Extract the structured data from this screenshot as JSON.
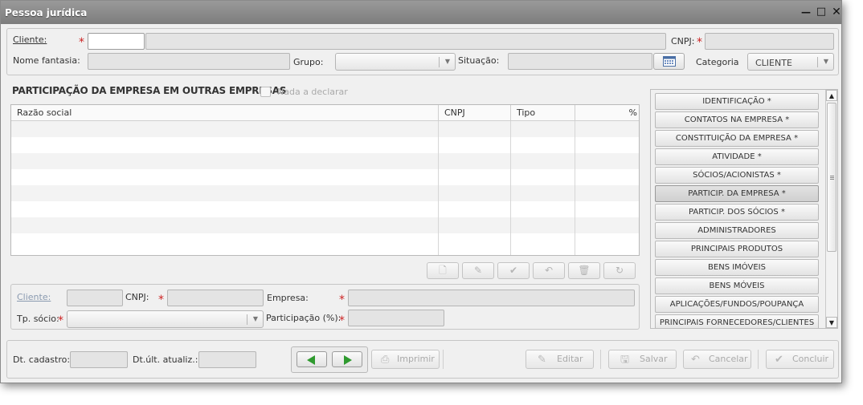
{
  "window": {
    "title": "Pessoa jurídica"
  },
  "header": {
    "cliente_label": "Cliente:",
    "cliente_value": "",
    "cliente_name": "",
    "cnpj_label": "CNPJ:",
    "nome_fantasia_label": "Nome fantasia:",
    "grupo_label": "Grupo:",
    "situacao_label": "Situação:",
    "categoria_label": "Categoria",
    "categoria_value": "CLIENTE"
  },
  "section": {
    "title": "PARTICIPAÇÃO DA EMPRESA EM OUTRAS EMPRESAS",
    "nada_label": "Nada a declarar"
  },
  "grid": {
    "columns": [
      "Razão social",
      "CNPJ",
      "Tipo",
      "%"
    ],
    "rows": []
  },
  "detail": {
    "cliente_label": "Cliente:",
    "cnpj_label": "CNPJ:",
    "empresa_label": "Empresa:",
    "tp_socio_label": "Tp. sócio:",
    "participacao_label": "Participação (%):"
  },
  "nav": {
    "items": [
      "IDENTIFICAÇÃO *",
      "CONTATOS NA EMPRESA *",
      "CONSTITUIÇÃO DA EMPRESA *",
      "ATIVIDADE *",
      "SÓCIOS/ACIONISTAS *",
      "PARTICIP. DA EMPRESA *",
      "PARTICIP. DOS SÓCIOS *",
      "ADMINISTRADORES",
      "PRINCIPAIS PRODUTOS",
      "BENS IMÓVEIS",
      "BENS MÓVEIS",
      "APLICAÇÕES/FUNDOS/POUPANÇA",
      "PRINCIPAIS FORNECEDORES/CLIENTES"
    ],
    "active_index": 5
  },
  "footer": {
    "dt_cadastro_label": "Dt. cadastro:",
    "dt_ult_label": "Dt.últ. atualiz.:",
    "imprimir": "Imprimir",
    "editar": "Editar",
    "salvar": "Salvar",
    "cancelar": "Cancelar",
    "concluir": "Concluir"
  },
  "colors": {
    "accent_green": "#2f9a2f",
    "required_red": "#cc2222",
    "titlebar": "#8a8a8a"
  }
}
